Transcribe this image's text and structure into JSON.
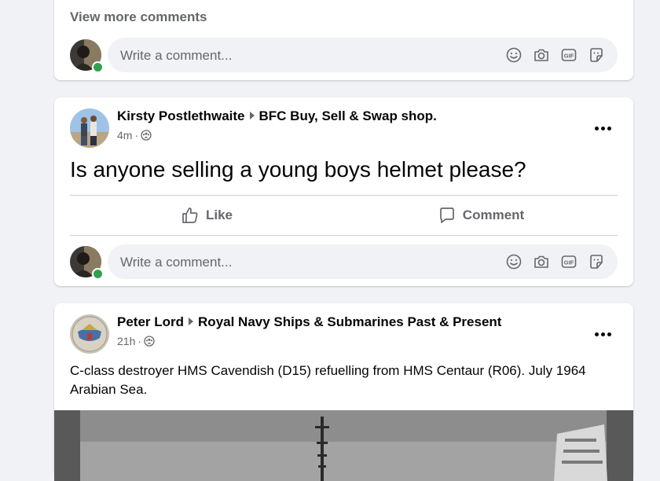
{
  "prev_post": {
    "view_more": "View more comments",
    "comment_placeholder": "Write a comment..."
  },
  "post1": {
    "author": "Kirsty Postlethwaite",
    "group": "BFC Buy, Sell & Swap shop.",
    "time": "4m",
    "separator": "·",
    "text": "Is anyone selling a young boys helmet please?",
    "like_label": "Like",
    "comment_label": "Comment",
    "comment_placeholder": "Write a comment..."
  },
  "post2": {
    "author": "Peter Lord",
    "group": "Royal Navy Ships & Submarines Past & Present",
    "time": "21h",
    "separator": "·",
    "text": "C-class destroyer HMS Cavendish (D15) refuelling from HMS Centaur (R06). July 1964 Arabian Sea."
  },
  "icons": {
    "emoji": "emoji-icon",
    "camera": "camera-icon",
    "gif": "gif-icon",
    "sticker": "sticker-icon",
    "privacy": "group-privacy-icon",
    "like": "thumbs-up-icon",
    "comment": "speech-bubble-icon",
    "more": "more-options-icon"
  },
  "colors": {
    "background": "#f0f2f5",
    "secondary_text": "#65676b",
    "online": "#31a24c"
  }
}
